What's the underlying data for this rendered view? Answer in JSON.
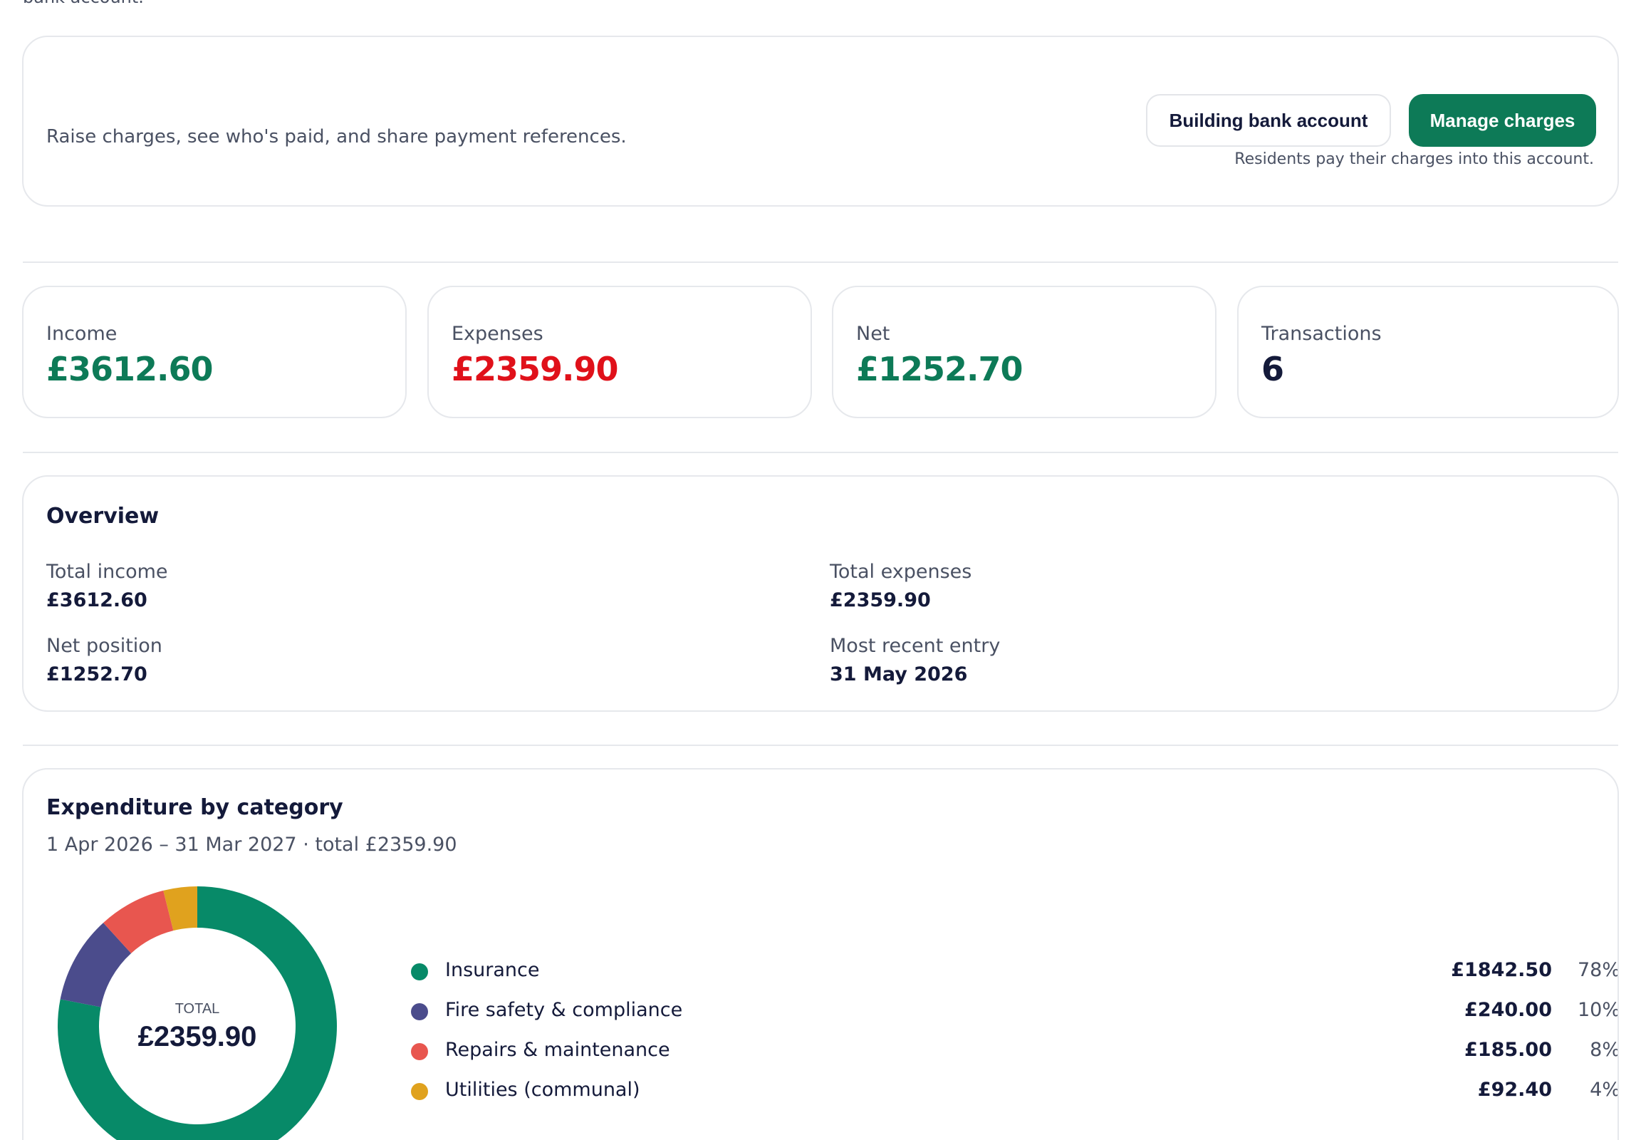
{
  "intro": {
    "tail_text": "bank account."
  },
  "charges": {
    "description": "Raise charges, see who's paid, and share payment references.",
    "bank_button_label": "Building bank account",
    "manage_button_label": "Manage charges",
    "bank_note": "Residents pay their charges into this account."
  },
  "stats": [
    {
      "label": "Income",
      "value": "£3612.60",
      "color": "#0d7a57"
    },
    {
      "label": "Expenses",
      "value": "£2359.90",
      "color": "#e0111a"
    },
    {
      "label": "Net",
      "value": "£1252.70",
      "color": "#0d7a57"
    },
    {
      "label": "Transactions",
      "value": "6",
      "color": "#141a3a"
    }
  ],
  "overview": {
    "title": "Overview",
    "items": [
      {
        "label": "Total income",
        "value": "£3612.60"
      },
      {
        "label": "Total expenses",
        "value": "£2359.90"
      },
      {
        "label": "Net position",
        "value": "£1252.70"
      },
      {
        "label": "Most recent entry",
        "value": "31 May 2026"
      }
    ]
  },
  "expenditure": {
    "title": "Expenditure by category",
    "subtitle": "1 Apr 2026 – 31 Mar 2027 · total £2359.90",
    "donut_caption": "TOTAL",
    "donut_total": "£2359.90"
  },
  "chart_data": {
    "type": "pie",
    "variant": "donut",
    "categories": [
      "Insurance",
      "Fire safety & compliance",
      "Repairs & maintenance",
      "Utilities (communal)"
    ],
    "values": [
      1842.5,
      240.0,
      185.0,
      92.4
    ],
    "amount_labels": [
      "£1842.50",
      "£240.00",
      "£185.00",
      "£92.40"
    ],
    "percent_labels": [
      "78%",
      "10%",
      "8%",
      "4%"
    ],
    "colors": [
      "#078a68",
      "#4b4c8c",
      "#e8564f",
      "#e0a21e"
    ],
    "legend_placement": "right"
  }
}
